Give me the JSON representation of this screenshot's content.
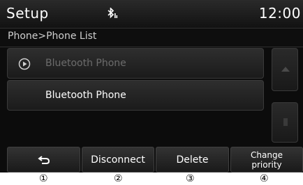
{
  "header": {
    "title": "Setup",
    "time": "12:00",
    "status_icon": "bluetooth-audio-icon"
  },
  "breadcrumb": {
    "text": "Phone>Phone List"
  },
  "list": {
    "items": [
      {
        "label": "Bluetooth Phone",
        "state": "dimmed",
        "icon": "play-circle-icon"
      },
      {
        "label": "Bluetooth Phone",
        "state": "normal"
      }
    ]
  },
  "scroll": {
    "up_icon": "chevron-up-icon",
    "down_icon": "chevron-down-icon"
  },
  "buttons": {
    "back_icon": "back-arrow-icon",
    "disconnect": "Disconnect",
    "delete": "Delete",
    "change_priority": "Change priority"
  },
  "callouts": [
    "①",
    "②",
    "③",
    "④"
  ],
  "colors": {
    "background": "#0c0c0c",
    "text": "#ffffff",
    "dim_text": "#6c6c6c"
  }
}
